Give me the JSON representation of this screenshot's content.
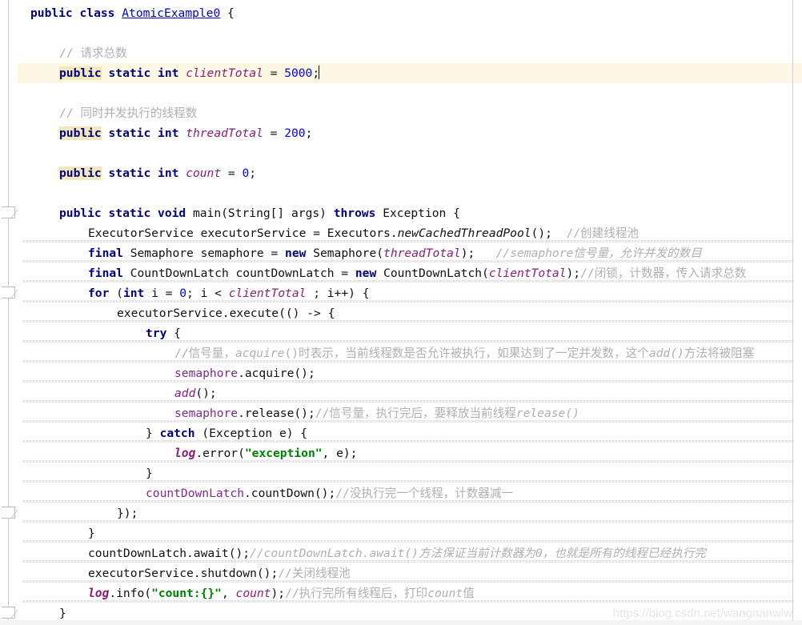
{
  "editor": {
    "language": "java",
    "file_class": "AtomicExample0",
    "right_margin_column_guide": true,
    "current_line_number": 4,
    "colors": {
      "keyword": "#000080",
      "class_link": "#0000c8",
      "field": "#871f78",
      "local_var": "#7a2d8c",
      "number": "#0000ff",
      "string": "#008000",
      "comment": "#b0b0b0",
      "current_line_bg": "#fdf8e3",
      "occurrence_highlight_bg": "#f3e7bd",
      "background": "#ffffff",
      "margin_guide": "#cfcfcf"
    }
  },
  "watermark": {
    "text": "https://blog.csdn.net/wangnanwlw"
  },
  "code": {
    "lines": [
      {
        "n": 1,
        "indent": 0,
        "tokens": [
          {
            "t": "public",
            "c": "kw"
          },
          {
            "t": " ",
            "c": "punct"
          },
          {
            "t": "class",
            "c": "kw"
          },
          {
            "t": " ",
            "c": "punct"
          },
          {
            "t": "AtomicExample0",
            "c": "cls"
          },
          {
            "t": " {",
            "c": "punct"
          }
        ]
      },
      {
        "n": 2,
        "indent": 0,
        "tokens": []
      },
      {
        "n": 3,
        "indent": 1,
        "tokens": [
          {
            "t": "// 请求总数",
            "c": "cmt"
          }
        ]
      },
      {
        "n": 4,
        "indent": 1,
        "current": true,
        "caret_after": true,
        "tokens": [
          {
            "t": "public",
            "c": "kw-hl"
          },
          {
            "t": " ",
            "c": "punct"
          },
          {
            "t": "static",
            "c": "kw"
          },
          {
            "t": " ",
            "c": "punct"
          },
          {
            "t": "int",
            "c": "kw"
          },
          {
            "t": " ",
            "c": "punct"
          },
          {
            "t": "clientTotal",
            "c": "field"
          },
          {
            "t": " = ",
            "c": "punct"
          },
          {
            "t": "5000",
            "c": "num"
          },
          {
            "t": ";",
            "c": "punct"
          }
        ]
      },
      {
        "n": 5,
        "indent": 0,
        "tokens": []
      },
      {
        "n": 6,
        "indent": 1,
        "tokens": [
          {
            "t": "// 同时并发执行的线程数",
            "c": "cmt"
          }
        ]
      },
      {
        "n": 7,
        "indent": 1,
        "tokens": [
          {
            "t": "public",
            "c": "kw-hl"
          },
          {
            "t": " ",
            "c": "punct"
          },
          {
            "t": "static",
            "c": "kw"
          },
          {
            "t": " ",
            "c": "punct"
          },
          {
            "t": "int",
            "c": "kw"
          },
          {
            "t": " ",
            "c": "punct"
          },
          {
            "t": "threadTotal",
            "c": "field"
          },
          {
            "t": " = ",
            "c": "punct"
          },
          {
            "t": "200",
            "c": "num"
          },
          {
            "t": ";",
            "c": "punct"
          }
        ]
      },
      {
        "n": 8,
        "indent": 0,
        "tokens": []
      },
      {
        "n": 9,
        "indent": 1,
        "tokens": [
          {
            "t": "public",
            "c": "kw-hl"
          },
          {
            "t": " ",
            "c": "punct"
          },
          {
            "t": "static",
            "c": "kw"
          },
          {
            "t": " ",
            "c": "punct"
          },
          {
            "t": "int",
            "c": "kw"
          },
          {
            "t": " ",
            "c": "punct"
          },
          {
            "t": "count",
            "c": "field"
          },
          {
            "t": " = ",
            "c": "punct"
          },
          {
            "t": "0",
            "c": "num"
          },
          {
            "t": ";",
            "c": "punct"
          }
        ]
      },
      {
        "n": 10,
        "indent": 0,
        "tokens": []
      },
      {
        "n": 11,
        "indent": 1,
        "fold": true,
        "tokens": [
          {
            "t": "public",
            "c": "kw"
          },
          {
            "t": " ",
            "c": "punct"
          },
          {
            "t": "static",
            "c": "kw"
          },
          {
            "t": " ",
            "c": "punct"
          },
          {
            "t": "void",
            "c": "kw"
          },
          {
            "t": " ",
            "c": "punct"
          },
          {
            "t": "main",
            "c": "punct"
          },
          {
            "t": "(String[] args) ",
            "c": "punct"
          },
          {
            "t": "throws",
            "c": "kw"
          },
          {
            "t": " Exception {",
            "c": "punct"
          }
        ]
      },
      {
        "n": 12,
        "indent": 2,
        "squiggle": true,
        "tokens": [
          {
            "t": "ExecutorService executorService = Executors.",
            "c": "punct"
          },
          {
            "t": "newCachedThreadPool",
            "c": "method"
          },
          {
            "t": "();  ",
            "c": "punct"
          },
          {
            "t": "//创建线程池",
            "c": "cmt"
          }
        ]
      },
      {
        "n": 13,
        "indent": 2,
        "squiggle": true,
        "tokens": [
          {
            "t": "final",
            "c": "kw"
          },
          {
            "t": " Semaphore semaphore = ",
            "c": "punct"
          },
          {
            "t": "new",
            "c": "kw"
          },
          {
            "t": " Semaphore(",
            "c": "punct"
          },
          {
            "t": "threadTotal",
            "c": "field"
          },
          {
            "t": ");   ",
            "c": "punct"
          },
          {
            "t": "//semaphore信号量，允许并发的数目",
            "c": "cmt-i"
          }
        ]
      },
      {
        "n": 14,
        "indent": 2,
        "squiggle": true,
        "tokens": [
          {
            "t": "final",
            "c": "kw"
          },
          {
            "t": " CountDownLatch countDownLatch = ",
            "c": "punct"
          },
          {
            "t": "new",
            "c": "kw"
          },
          {
            "t": " CountDownLatch(",
            "c": "punct"
          },
          {
            "t": "clientTotal",
            "c": "field"
          },
          {
            "t": ");",
            "c": "punct"
          },
          {
            "t": "//闭锁，计数器，传入请求总数",
            "c": "cmt"
          }
        ]
      },
      {
        "n": 15,
        "indent": 2,
        "squiggle": true,
        "fold": true,
        "tokens": [
          {
            "t": "for",
            "c": "kw"
          },
          {
            "t": " (",
            "c": "punct"
          },
          {
            "t": "int",
            "c": "kw"
          },
          {
            "t": " i = ",
            "c": "punct"
          },
          {
            "t": "0",
            "c": "num"
          },
          {
            "t": "; i < ",
            "c": "punct"
          },
          {
            "t": "clientTotal",
            "c": "field"
          },
          {
            "t": " ; i++) {",
            "c": "punct"
          }
        ]
      },
      {
        "n": 16,
        "indent": 3,
        "squiggle": true,
        "tokens": [
          {
            "t": "executorService.execute(() -> {",
            "c": "punct"
          }
        ]
      },
      {
        "n": 17,
        "indent": 4,
        "squiggle": true,
        "tokens": [
          {
            "t": "try",
            "c": "kw"
          },
          {
            "t": " {",
            "c": "punct"
          }
        ]
      },
      {
        "n": 18,
        "indent": 5,
        "squiggle": true,
        "tokens": [
          {
            "t": "//信号量，",
            "c": "cmt"
          },
          {
            "t": "acquire",
            "c": "cmt-i"
          },
          {
            "t": "()时表示，当前线程数是否允许被执行，如果达到了一定并发数，这个",
            "c": "cmt"
          },
          {
            "t": "add",
            "c": "cmt-i"
          },
          {
            "t": "()",
            "c": "cmt-i"
          },
          {
            "t": "方法将被阻塞",
            "c": "cmt"
          }
        ]
      },
      {
        "n": 19,
        "indent": 5,
        "squiggle": true,
        "tokens": [
          {
            "t": "semaphore",
            "c": "localvar"
          },
          {
            "t": ".acquire();",
            "c": "punct"
          }
        ]
      },
      {
        "n": 20,
        "indent": 5,
        "squiggle": true,
        "tokens": [
          {
            "t": "add",
            "c": "methodp"
          },
          {
            "t": "();",
            "c": "punct"
          }
        ]
      },
      {
        "n": 21,
        "indent": 5,
        "squiggle": true,
        "tokens": [
          {
            "t": "semaphore",
            "c": "localvar"
          },
          {
            "t": ".release();",
            "c": "punct"
          },
          {
            "t": "//信号量，执行完后，要释放当前线程",
            "c": "cmt"
          },
          {
            "t": "release()",
            "c": "cmt-i"
          }
        ]
      },
      {
        "n": 22,
        "indent": 4,
        "squiggle": true,
        "tokens": [
          {
            "t": "} ",
            "c": "punct"
          },
          {
            "t": "catch",
            "c": "kw"
          },
          {
            "t": " (Exception e) {",
            "c": "punct"
          }
        ]
      },
      {
        "n": 23,
        "indent": 5,
        "squiggle": true,
        "tokens": [
          {
            "t": "log",
            "c": "fieldb"
          },
          {
            "t": ".error(",
            "c": "punct"
          },
          {
            "t": "\"exception\"",
            "c": "str"
          },
          {
            "t": ", e);",
            "c": "punct"
          }
        ]
      },
      {
        "n": 24,
        "indent": 4,
        "squiggle": true,
        "tokens": [
          {
            "t": "}",
            "c": "punct"
          }
        ]
      },
      {
        "n": 25,
        "indent": 4,
        "squiggle": true,
        "tokens": [
          {
            "t": "countDownLatch",
            "c": "localvar"
          },
          {
            "t": ".countDown();",
            "c": "punct"
          },
          {
            "t": "//没执行完一个线程，计数器减一",
            "c": "cmt"
          }
        ]
      },
      {
        "n": 26,
        "indent": 3,
        "squiggle": true,
        "fold": true,
        "tokens": [
          {
            "t": "});",
            "c": "punct"
          }
        ]
      },
      {
        "n": 27,
        "indent": 2,
        "squiggle": true,
        "tokens": [
          {
            "t": "}",
            "c": "punct"
          }
        ]
      },
      {
        "n": 28,
        "indent": 2,
        "squiggle": true,
        "tokens": [
          {
            "t": "countDownLatch.await();",
            "c": "punct"
          },
          {
            "t": "//countDownLatch.await()方法保证当前计数器为0，也就是所有的线程已经执行完",
            "c": "cmt-i"
          }
        ]
      },
      {
        "n": 29,
        "indent": 2,
        "squiggle": true,
        "tokens": [
          {
            "t": "executorService.shutdown();",
            "c": "punct"
          },
          {
            "t": "//关闭线程池",
            "c": "cmt"
          }
        ]
      },
      {
        "n": 30,
        "indent": 2,
        "squiggle": true,
        "tokens": [
          {
            "t": "log",
            "c": "fieldb"
          },
          {
            "t": ".info(",
            "c": "punct"
          },
          {
            "t": "\"count:{}\"",
            "c": "str"
          },
          {
            "t": ", ",
            "c": "punct"
          },
          {
            "t": "count",
            "c": "field"
          },
          {
            "t": ");",
            "c": "punct"
          },
          {
            "t": "//执行完所有线程后，打印",
            "c": "cmt"
          },
          {
            "t": "count",
            "c": "cmt-i"
          },
          {
            "t": "值",
            "c": "cmt"
          }
        ]
      },
      {
        "n": 31,
        "indent": 1,
        "squiggle": true,
        "fold": true,
        "tokens": [
          {
            "t": "}",
            "c": "punct"
          }
        ]
      }
    ]
  }
}
